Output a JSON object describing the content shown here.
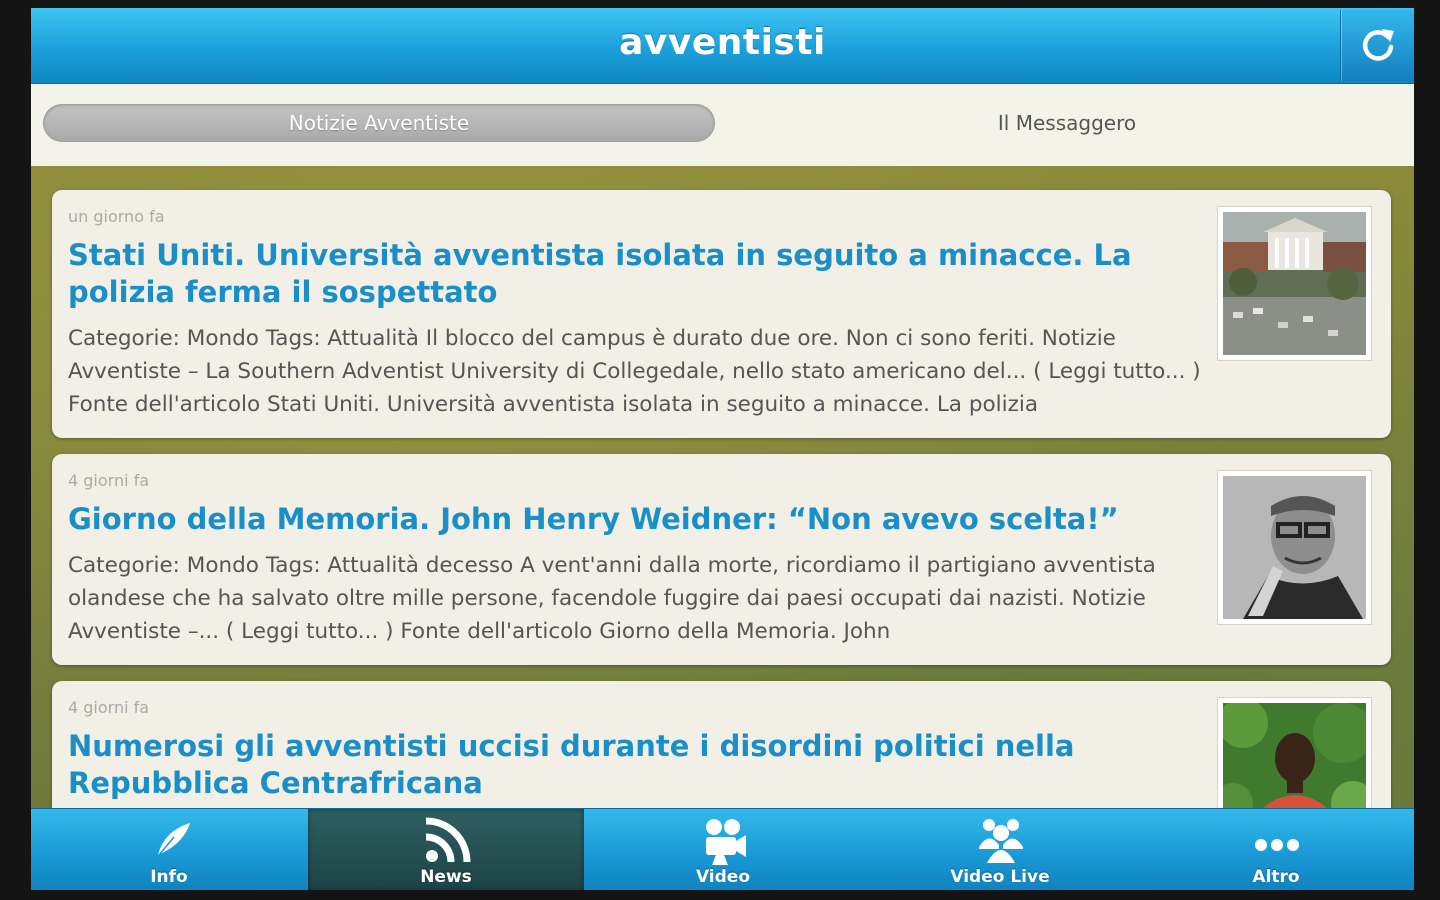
{
  "header": {
    "title": "avventisti",
    "refresh_icon": "refresh-icon"
  },
  "segments": {
    "active": "Notizie Avventiste",
    "inactive": "Il Messaggero"
  },
  "articles": [
    {
      "time": "un giorno fa",
      "title": "Stati Uniti. Università avventista isolata in seguito a minacce. La polizia ferma il sospettato",
      "summary": "Categorie: Mondo Tags: Attualità Il blocco del campus è durato due ore. Non ci sono feriti. Notizie Avventiste – La Southern Adventist University di Collegedale, nello stato americano del... ( Leggi tutto... ) Fonte dell'articolo Stati Uniti. Università avventista isolata in seguito a minacce. La polizia"
    },
    {
      "time": "4 giorni fa",
      "title": "Giorno della Memoria. John Henry Weidner: “Non avevo scelta!”",
      "summary": "Categorie: Mondo Tags: Attualità decesso A vent'anni dalla morte, ricordiamo il partigiano avventista olandese che ha salvato oltre mille persone, facendole fuggire dai paesi occupati dai nazisti. Notizie Avventiste –... ( Leggi tutto... ) Fonte dell'articolo Giorno della Memoria. John"
    },
    {
      "time": "4 giorni fa",
      "title": "Numerosi gli avventisti uccisi durante i disordini politici nella Repubblica Centrafricana",
      "summary": ""
    }
  ],
  "tabs": [
    {
      "label": "Info",
      "icon": "feather-icon"
    },
    {
      "label": "News",
      "icon": "rss-icon"
    },
    {
      "label": "Video",
      "icon": "video-camera-icon"
    },
    {
      "label": "Video Live",
      "icon": "group-icon"
    },
    {
      "label": "Altro",
      "icon": "more-icon"
    }
  ],
  "active_tab": "News",
  "colors": {
    "header_blue": "#1da3de",
    "title_blue": "#1a8fc7",
    "active_tab": "#244e50"
  }
}
